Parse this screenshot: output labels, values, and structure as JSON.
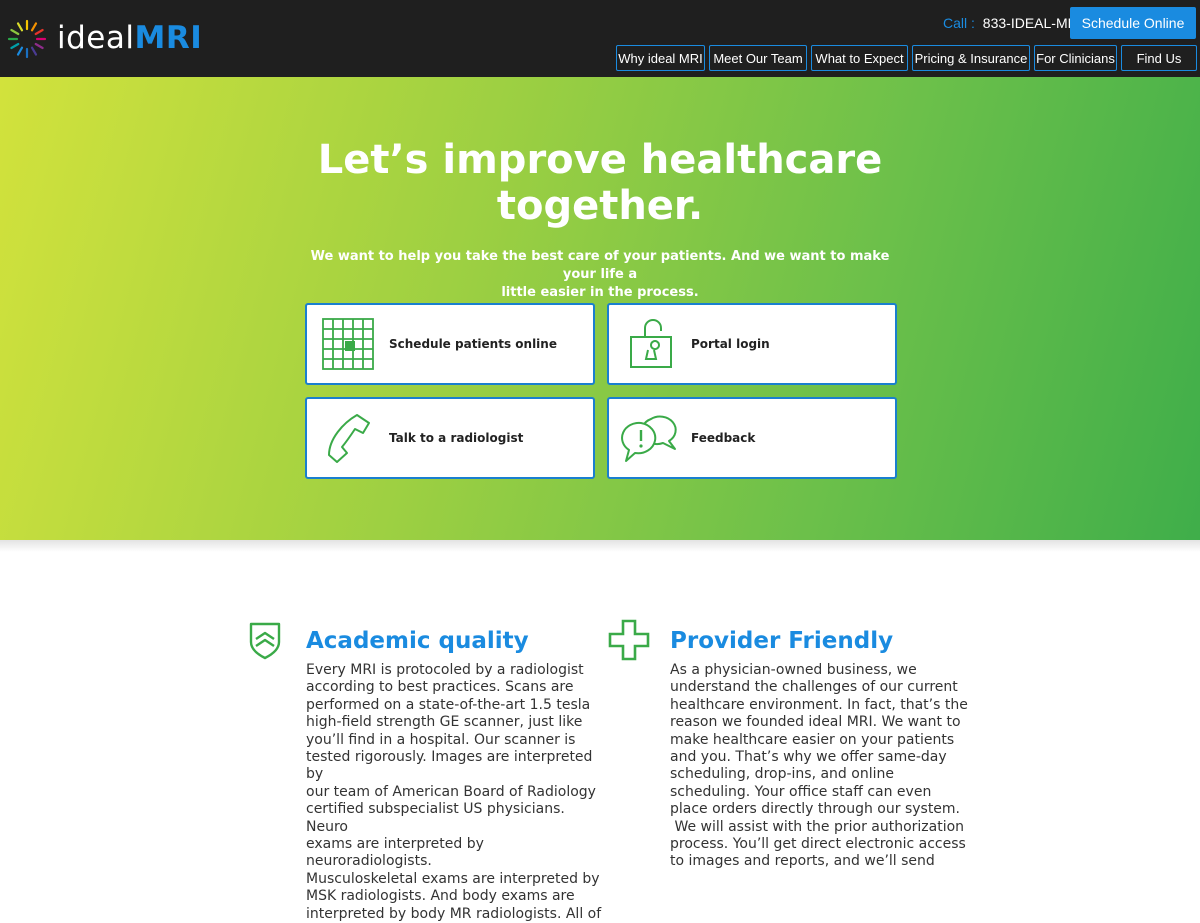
{
  "header": {
    "logo": {
      "text_ideal": "ideal",
      "text_mri": "MRI",
      "icon": "sunburst-logo-icon"
    },
    "call_label": "Call :",
    "call_number": "833-IDEAL-MR",
    "schedule_button": "Schedule Online",
    "nav": [
      "Why ideal MRI",
      "Meet Our Team",
      "What to Expect",
      "Pricing & Insurance",
      "For Clinicians",
      "Find Us"
    ]
  },
  "hero": {
    "title_line1": "Let’s improve healthcare",
    "title_line2": "together.",
    "subtitle_line1": "We want to help you take the best care of your patients. And we want to make your life a",
    "subtitle_line2": "little easier in the process.",
    "cards": [
      {
        "label": "Schedule patients online",
        "icon": "calendar-grid-icon"
      },
      {
        "label": "Portal login",
        "icon": "unlocked-padlock-icon"
      },
      {
        "label": "Talk to a radiologist",
        "icon": "phone-handset-icon"
      },
      {
        "label": "Feedback",
        "icon": "speech-bubbles-icon"
      }
    ]
  },
  "features": [
    {
      "title": "Academic quality",
      "icon": "shield-chevron-icon",
      "lines": [
        "Every MRI is protocoled by a radiologist",
        "according to best practices.  Scans are",
        "performed on a state-of-the-art 1.5 tesla",
        "high-field strength GE scanner, just like",
        "you’ll find in a hospital. Our scanner is",
        "tested rigorously. Images are interpreted by",
        "our team of American Board of Radiology",
        "certified subspecialist US physicians. Neuro",
        "exams are interpreted by neuroradiologists.",
        "Musculoskeletal exams are interpreted by",
        "MSK radiologists. And body exams are",
        "interpreted by body MR radiologists.  All of"
      ]
    },
    {
      "title": "Provider Friendly",
      "icon": "medical-cross-icon",
      "lines": [
        "As a physician-owned business, we",
        "understand the challenges of our current",
        "healthcare environment. In fact, that’s the",
        "reason we founded ideal MRI. We want to",
        "make healthcare easier on your patients",
        "and you. That’s why we offer same-day",
        "scheduling, drop-ins, and online",
        "scheduling.  Your office staff can even",
        "place orders directly through our system.",
        " We will assist with the prior authorization",
        "process. You’ll get direct electronic access",
        "to images and reports, and we’ll send"
      ]
    }
  ],
  "colors": {
    "brand_blue": "#1a8be0",
    "card_border": "#1a7fcf",
    "icon_green": "#3aaa48",
    "header_bg": "#1f1f1f"
  }
}
